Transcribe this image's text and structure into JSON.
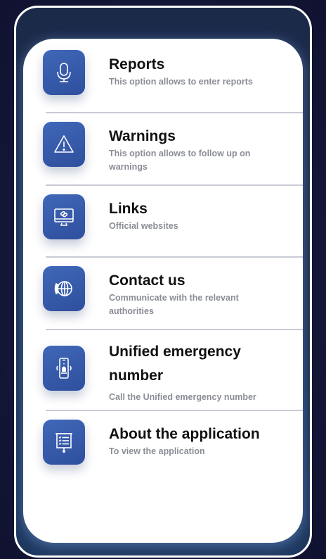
{
  "menu": {
    "items": [
      {
        "title": "Reports",
        "subtitle": "This option allows to enter reports",
        "icon": "microphone-icon"
      },
      {
        "title": "Warnings",
        "subtitle": "This option allows to follow up on warnings",
        "icon": "warning-triangle-icon"
      },
      {
        "title": "Links",
        "subtitle": "Official websites",
        "icon": "link-monitor-icon"
      },
      {
        "title": "Contact us",
        "subtitle": "Communicate with the relevant authorities",
        "icon": "globe-phone-icon"
      },
      {
        "title": "Unified emergency number",
        "subtitle": "Call the Unified emergency number",
        "icon": "emergency-phone-icon"
      },
      {
        "title": "About the application",
        "subtitle": "To view the application",
        "icon": "presentation-board-icon"
      }
    ]
  },
  "colors": {
    "accent": "#3a5eb0",
    "frame": "#ffffff",
    "background": "#181a3a",
    "subtitle": "#8a8d96"
  }
}
